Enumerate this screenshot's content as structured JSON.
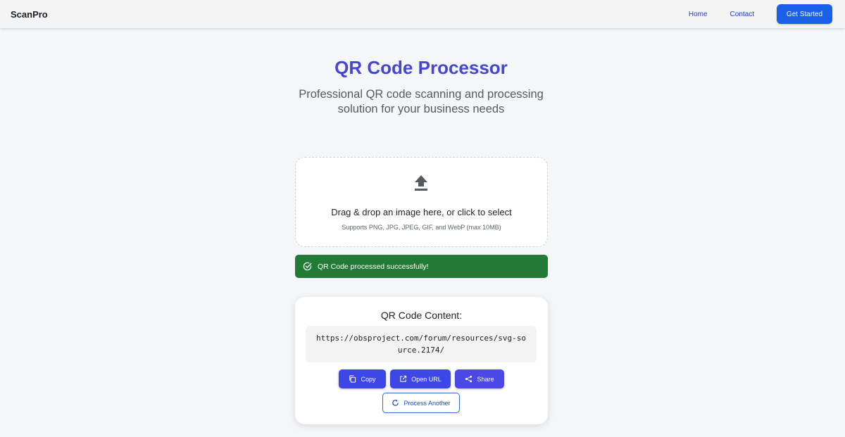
{
  "nav": {
    "brand": "ScanPro",
    "links": [
      "Home",
      "Contact"
    ],
    "cta": "Get Started",
    "accent": "#1a5fe8"
  },
  "hero": {
    "title": "QR Code Processor",
    "subtitle": "Professional QR code scanning and processing solution for your business needs",
    "title_color": "#4545d6"
  },
  "dropzone": {
    "icon": "upload-icon",
    "text": "Drag & drop an image here, or click to select",
    "hint": "Supports PNG, JPG, JPEG, GIF, and WebP (max 10MB)"
  },
  "status": {
    "icon": "check-circle-icon",
    "message": "QR Code processed successfully!",
    "color": "#227a35"
  },
  "result": {
    "title": "QR Code Content:",
    "content": "https://obsproject.com/forum/resources/svg-source.2174/",
    "actions": {
      "copy": {
        "label": "Copy",
        "icon": "copy-icon"
      },
      "open": {
        "label": "Open URL",
        "icon": "external-link-icon"
      },
      "share": {
        "label": "Share",
        "icon": "share-icon"
      }
    },
    "process_another": {
      "label": "Process Another",
      "icon": "refresh-icon"
    },
    "button_color": "#3d46e6"
  }
}
